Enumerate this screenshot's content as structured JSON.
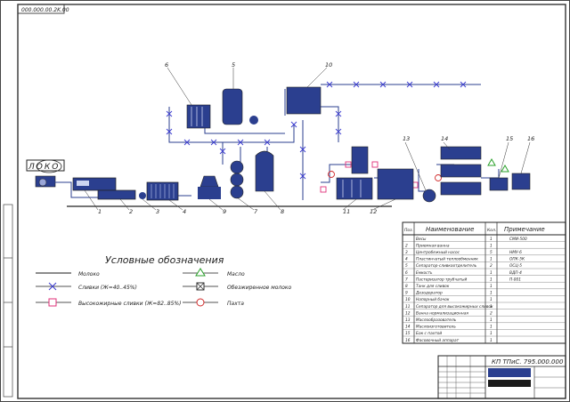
{
  "sheet": {
    "stamp_code": "000.000.00.2K.00",
    "locomotive_label": "ЛОКО",
    "doc_number": "КП ТПиС.  795.000.000"
  },
  "callouts": [
    "1",
    "2",
    "3",
    "4",
    "5",
    "6",
    "7",
    "8",
    "9",
    "10",
    "11",
    "12",
    "13",
    "14",
    "15",
    "16"
  ],
  "legend": {
    "title": "Условные обозначения",
    "items": [
      {
        "symbol": "line",
        "label": "Молоко"
      },
      {
        "symbol": "x",
        "label": "Сливки (Ж=40..45%)"
      },
      {
        "symbol": "square",
        "label": "Высокожирные сливки (Ж=82..85%)"
      },
      {
        "symbol": "triangle",
        "label": "Масло"
      },
      {
        "symbol": "xbox",
        "label": "Обезжиренное молоко"
      },
      {
        "symbol": "circle",
        "label": "Пахта"
      }
    ]
  },
  "spec_table": {
    "headers": [
      "Поз.",
      "Наименование",
      "Кол.",
      "Примечание"
    ],
    "rows": [
      {
        "pos": "",
        "name": "Весы",
        "qty": "1",
        "note": "СМИ-500"
      },
      {
        "pos": "2",
        "name": "Приемная ванна",
        "qty": "1",
        "note": ""
      },
      {
        "pos": "3",
        "name": "Центробежный насос",
        "qty": "5",
        "note": "НМУ-6"
      },
      {
        "pos": "4",
        "name": "Пластинчатый теплообменник",
        "qty": "1",
        "note": "ОПК-5К"
      },
      {
        "pos": "5",
        "name": "Сепаратор-сливкоотделитель",
        "qty": "2",
        "note": "ОСЦ-5"
      },
      {
        "pos": "6",
        "name": "Емкость",
        "qty": "1",
        "note": "ВДП-4"
      },
      {
        "pos": "7",
        "name": "Пастеризатор трубчатый",
        "qty": "1",
        "note": "П-001"
      },
      {
        "pos": "8",
        "name": "Танк для сливок",
        "qty": "1",
        "note": ""
      },
      {
        "pos": "9",
        "name": "Дезодоратор",
        "qty": "1",
        "note": ""
      },
      {
        "pos": "10",
        "name": "Напорный бачок",
        "qty": "1",
        "note": ""
      },
      {
        "pos": "11",
        "name": "Сепаратор для высокожирных сливок",
        "qty": "1",
        "note": ""
      },
      {
        "pos": "12",
        "name": "Ванна нормализационная",
        "qty": "2",
        "note": ""
      },
      {
        "pos": "13",
        "name": "Маслообразователь",
        "qty": "1",
        "note": ""
      },
      {
        "pos": "14",
        "name": "Маслоизготовитель",
        "qty": "1",
        "note": ""
      },
      {
        "pos": "15",
        "name": "Бак с пахтой",
        "qty": "1",
        "note": ""
      },
      {
        "pos": "16",
        "name": "Фасовочный аппарат",
        "qty": "1",
        "note": ""
      }
    ]
  },
  "colors": {
    "line": "#1a1a1a",
    "cream": "#3b3bd0",
    "hf_cream": "#e0307a",
    "butter": "#2aa02a",
    "skim": "#333333",
    "buttermilk": "#d12a2a",
    "equipment": "#2b3f8f"
  }
}
